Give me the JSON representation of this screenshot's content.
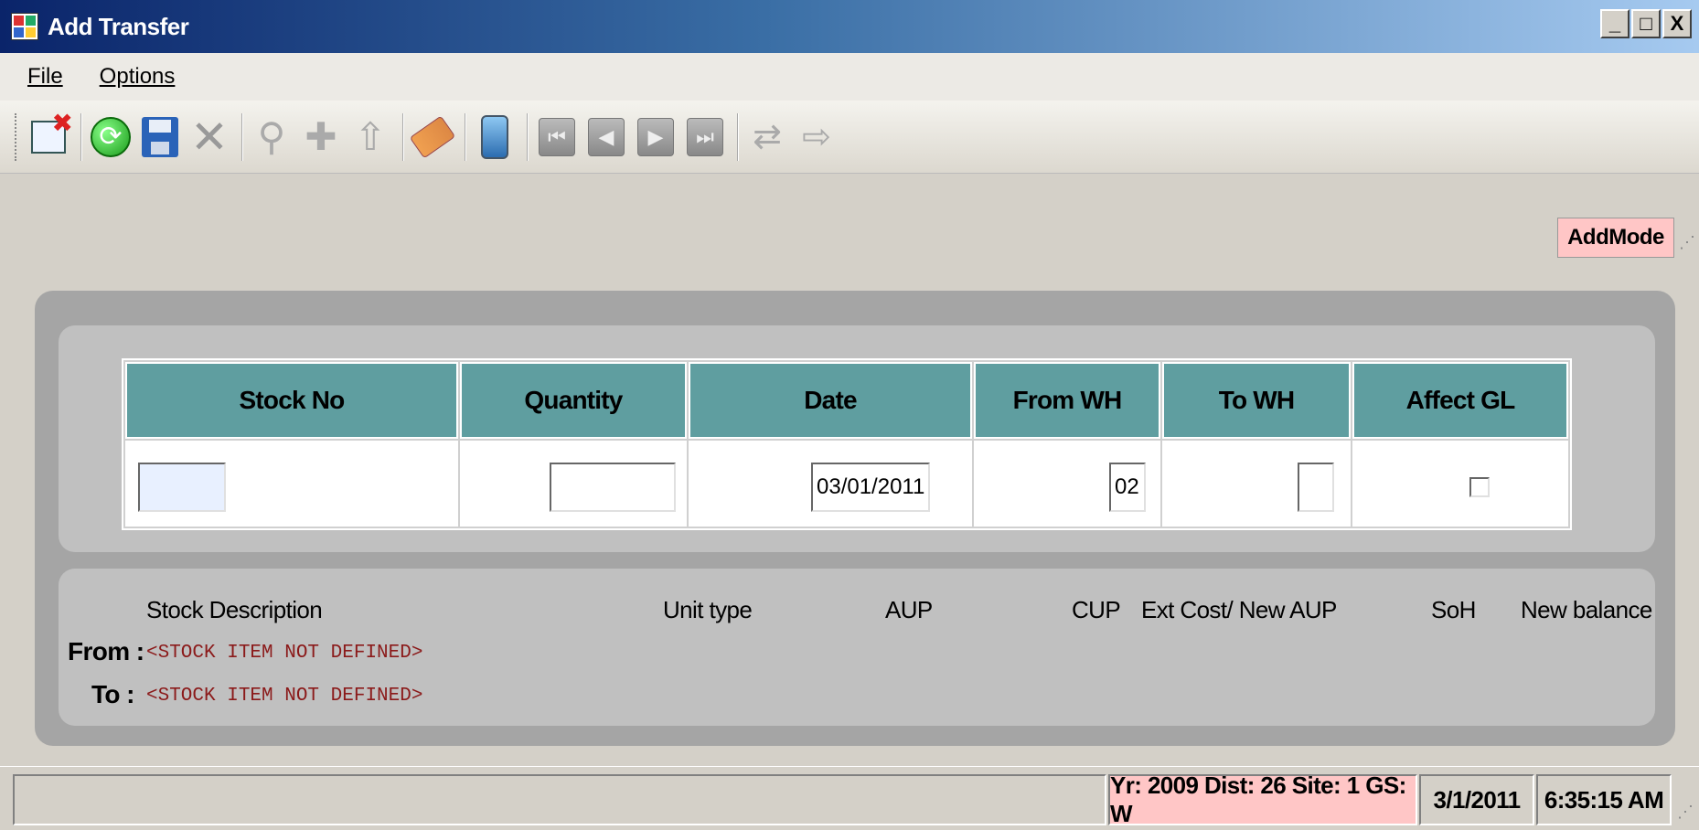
{
  "window": {
    "title": "Add Transfer",
    "controls": [
      "_",
      "□",
      "X"
    ]
  },
  "menu": {
    "file_label": "File",
    "options_label": "Options"
  },
  "toolbar": {
    "buttons": [
      "new-window-icon",
      "refresh-icon",
      "save-icon",
      "delete-icon",
      "find-icon",
      "add-icon",
      "upload-icon",
      "eraser-icon",
      "device-icon",
      "first-record-icon",
      "previous-record-icon",
      "next-record-icon",
      "last-record-icon",
      "transfer-icon",
      "export-icon"
    ]
  },
  "mode_badge": "AddMode",
  "grid": {
    "columns": [
      "Stock No",
      "Quantity",
      "Date",
      "From WH",
      "To WH",
      "Affect GL"
    ],
    "row": {
      "stock_no": "",
      "quantity": "",
      "date": "03/01/2011",
      "from_wh": "02",
      "to_wh": "",
      "affect_gl": false
    },
    "header_color": "#5f9ea0"
  },
  "info": {
    "headers": {
      "stock_description": "Stock Description",
      "unit_type": "Unit type",
      "aup": "AUP",
      "cup": "CUP",
      "ext_cost": "Ext Cost/ New AUP",
      "soh": "SoH",
      "new_balance": "New balance"
    },
    "from_label": "From",
    "to_label": "To",
    "from_value": "<STOCK ITEM NOT DEFINED>",
    "to_value": "<STOCK ITEM NOT DEFINED>"
  },
  "status": {
    "context": "Yr: 2009 Dist: 26 Site: 1 GS: W",
    "date": "3/1/2011",
    "time": "6:35:15 AM",
    "highlight_color": "#ffc6c6"
  }
}
